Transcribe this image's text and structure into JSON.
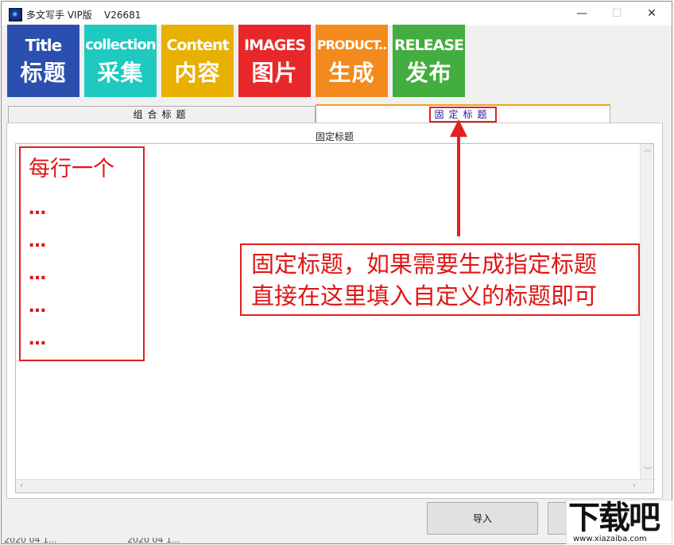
{
  "window": {
    "title": "多文写手 VIP版    V26681",
    "minimize": "—",
    "maximize": "☐",
    "close": "✕"
  },
  "toolbar": [
    {
      "en": "Title",
      "cn": "标题",
      "color": "#2a4fae"
    },
    {
      "en": "collection",
      "cn": "采集",
      "color": "#1ec9c0"
    },
    {
      "en": "Content",
      "cn": "内容",
      "color": "#e8b000"
    },
    {
      "en": "IMAGES",
      "cn": "图片",
      "color": "#e8272a"
    },
    {
      "en": "PRODUCT..",
      "cn": "生成",
      "color": "#f28a1e"
    },
    {
      "en": "RELEASE",
      "cn": "发布",
      "color": "#44ad3f"
    }
  ],
  "tabs": [
    {
      "label": "组合标题",
      "active": false
    },
    {
      "label": "固定标题",
      "active": true
    }
  ],
  "panel": {
    "group_label": "固定标题"
  },
  "annotations": {
    "left": {
      "title": "每行一个",
      "dots": [
        "…",
        "…",
        "…",
        "…",
        "…"
      ]
    },
    "right": {
      "line1": "固定标题，如果需要生成指定标题",
      "line2": "直接在这里填入自定义的标题即可"
    }
  },
  "buttons": {
    "import": "导入"
  },
  "bottom": {
    "left_text": "2020 04 1...",
    "mid_text": "2020 04 1..."
  },
  "watermark": {
    "main": "下载吧",
    "url": "www.xiazaiba.com"
  },
  "colors": {
    "annotation_red": "#e02020",
    "active_tab_accent": "#f0a020"
  }
}
